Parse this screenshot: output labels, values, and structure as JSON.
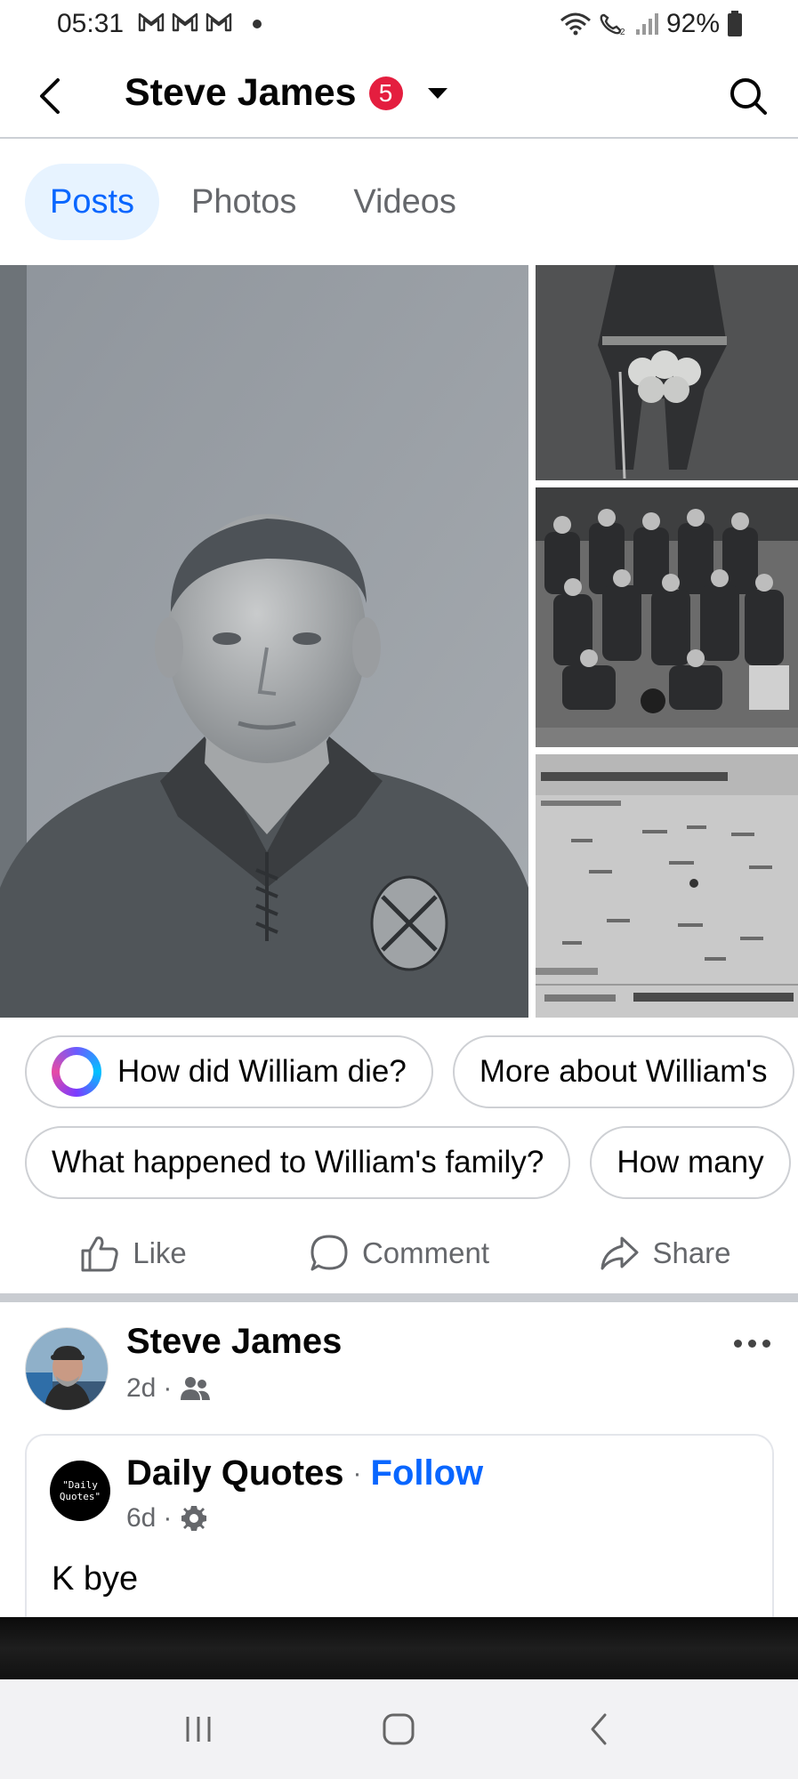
{
  "status_bar": {
    "time": "05:31",
    "battery": "92%",
    "mail_icons": [
      "gmail-icon",
      "gmail-icon",
      "gmail-icon"
    ]
  },
  "header": {
    "title": "Steve James",
    "badge_count": "5"
  },
  "tabs": [
    {
      "label": "Posts",
      "active": true
    },
    {
      "label": "Photos",
      "active": false
    },
    {
      "label": "Videos",
      "active": false
    }
  ],
  "suggestions": {
    "row1": [
      "How did William die?",
      "More about William's"
    ],
    "row2": [
      "What happened to William's family?",
      "How many"
    ]
  },
  "actions": {
    "like": "Like",
    "comment": "Comment",
    "share": "Share"
  },
  "post": {
    "author": "Steve James",
    "time": "2d",
    "audience_icon": "friends-icon",
    "shared": {
      "page_name": "Daily Quotes",
      "follow_label": "Follow",
      "time": "6d",
      "avatar_text": "\"Daily Quotes\"",
      "text": "K bye"
    }
  },
  "colors": {
    "accent": "#0866ff",
    "badge": "#e41e3f",
    "secondary_text": "#65676b"
  }
}
